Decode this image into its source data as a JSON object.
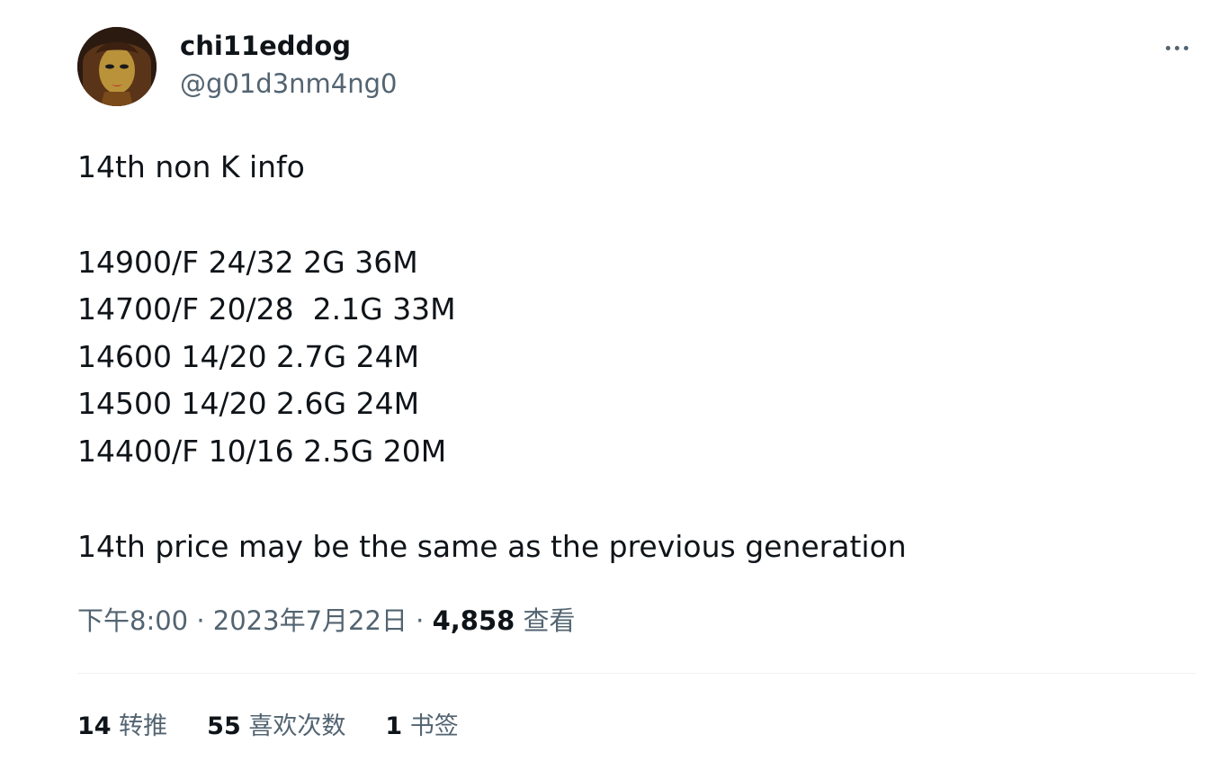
{
  "author": {
    "display_name": "chi11eddog",
    "handle": "@g01d3nm4ng0",
    "avatar_icon": "avatar-portrait"
  },
  "more_icon": "more-dots-icon",
  "tweet": {
    "lines": [
      "14th non K info",
      "",
      "14900/F 24/32 2G 36M",
      "14700/F 20/28  2.1G 33M",
      "14600 14/20 2.7G 24M",
      "14500 14/20 2.6G 24M",
      "14400/F 10/16 2.5G 20M",
      "",
      "14th price may be the same as the previous generation"
    ]
  },
  "meta": {
    "time": "下午8:00",
    "separator": " · ",
    "date": "2023年7月22日",
    "views_count": "4,858",
    "views_label": " 查看"
  },
  "stats": {
    "retweets_count": "14",
    "retweets_label": " 转推",
    "likes_count": "55",
    "likes_label": " 喜欢次数",
    "bookmarks_count": "1",
    "bookmarks_label": " 书签"
  }
}
